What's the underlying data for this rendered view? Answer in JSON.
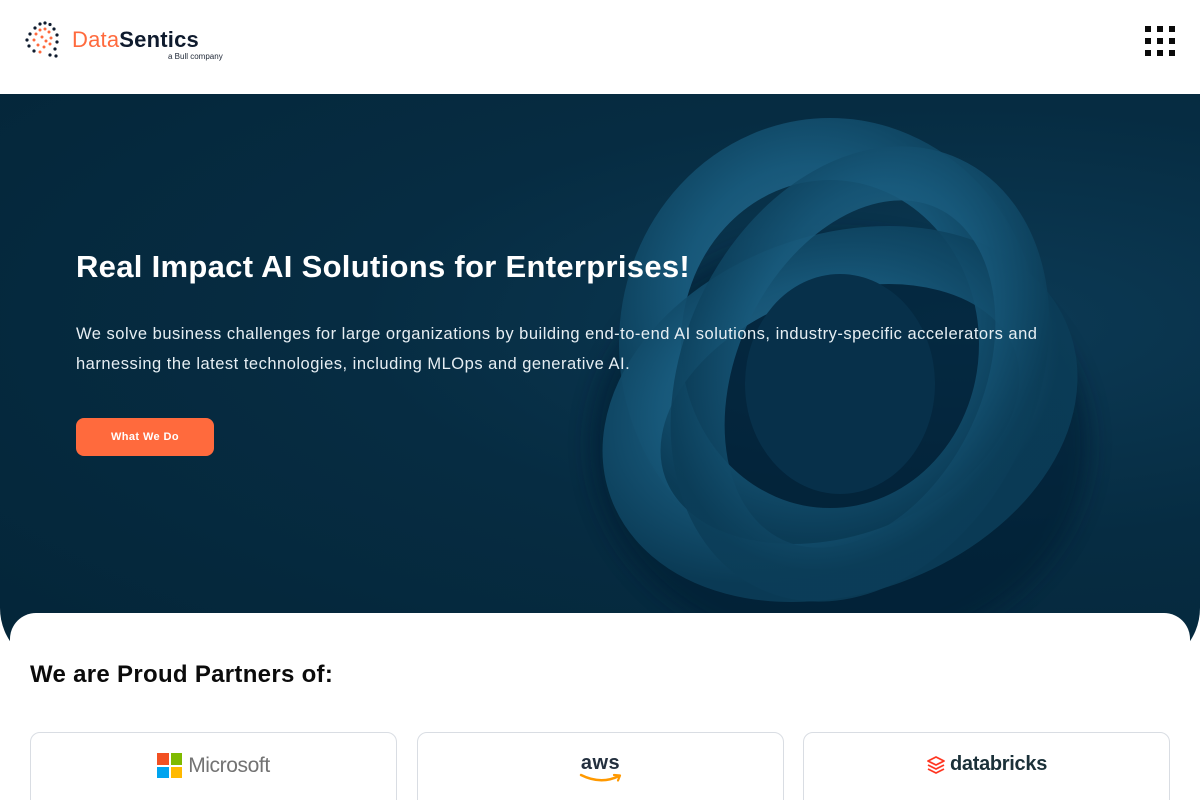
{
  "header": {
    "logo": {
      "brand_part_a": "Data",
      "brand_part_b": "Sentics",
      "tagline": "a Bull company"
    },
    "menu_icon": "grid-menu-icon"
  },
  "hero": {
    "title": "Real Impact AI Solutions for Enterprises!",
    "description": "We solve business challenges for large organizations by building end-to-end AI solutions, industry-specific accelerators and harnessing the latest technologies, including MLOps and generative AI.",
    "cta_label": "What We Do",
    "graphic": "torus-ring-graphic"
  },
  "partners": {
    "title": "We are Proud Partners of:",
    "items": [
      {
        "name": "Microsoft",
        "icon": "microsoft-logo-icon"
      },
      {
        "name": "aws",
        "icon": "aws-logo-icon"
      },
      {
        "name": "databricks",
        "icon": "databricks-logo-icon"
      }
    ]
  },
  "colors": {
    "accent": "#ff6a3d",
    "hero_bg": "#062c42",
    "text_dark": "#0b0b0b",
    "ms_red": "#f25022",
    "ms_green": "#7fba00",
    "ms_blue": "#00a4ef",
    "ms_yellow": "#ffb900",
    "aws_orange": "#ff9900",
    "databricks_red": "#ff3621"
  }
}
